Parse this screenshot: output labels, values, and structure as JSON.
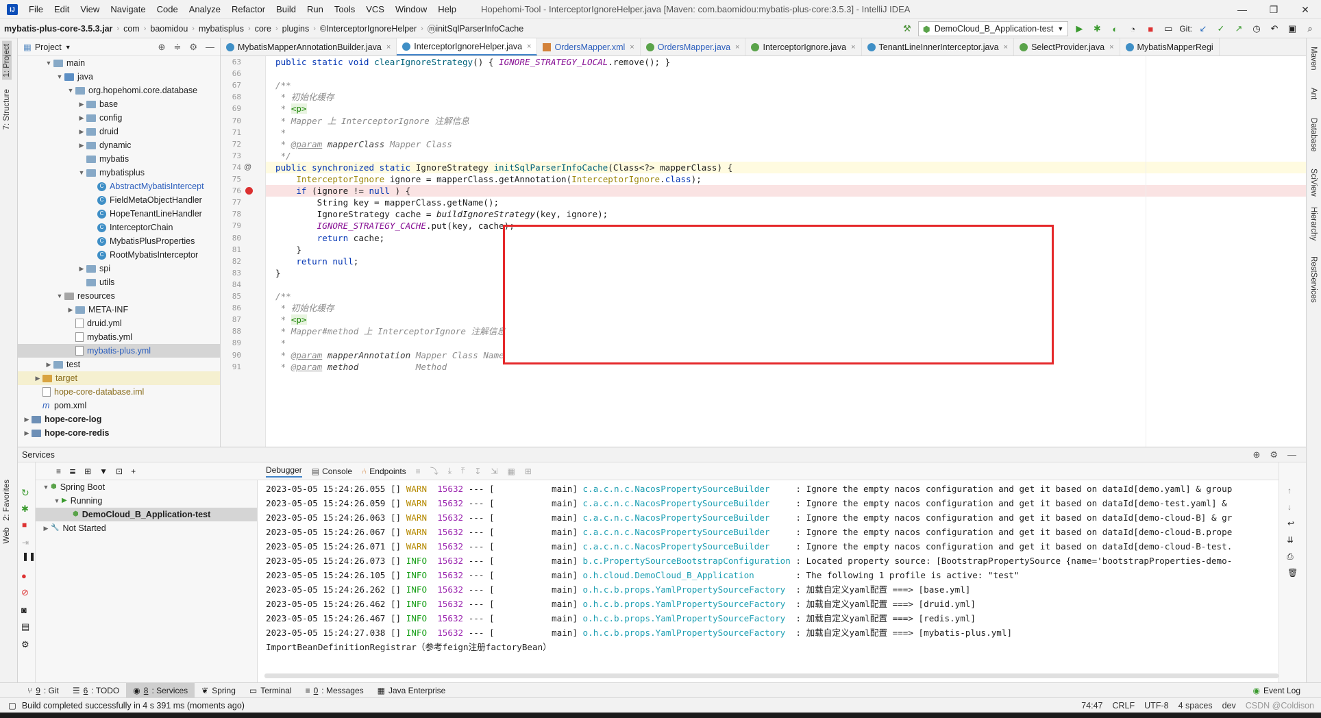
{
  "menubar": {
    "items": [
      "File",
      "Edit",
      "View",
      "Navigate",
      "Code",
      "Analyze",
      "Refactor",
      "Build",
      "Run",
      "Tools",
      "VCS",
      "Window",
      "Help"
    ],
    "window_title": "Hopehomi-Tool - InterceptorIgnoreHelper.java [Maven: com.baomidou:mybatis-plus-core:3.5.3] - IntelliJ IDEA"
  },
  "navbar": {
    "crumbs": [
      "mybatis-plus-core-3.5.3.jar",
      "com",
      "baomidou",
      "mybatisplus",
      "core",
      "plugins",
      "InterceptorIgnoreHelper",
      "initSqlParserInfoCache"
    ],
    "run_config": "DemoCloud_B_Application-test",
    "git_label": "Git:"
  },
  "project": {
    "title": "Project",
    "tree": [
      {
        "label": "main",
        "depth": 2,
        "arrow": "▼",
        "icon": "folder"
      },
      {
        "label": "java",
        "depth": 3,
        "arrow": "▼",
        "icon": "src"
      },
      {
        "label": "org.hopehomi.core.database",
        "depth": 4,
        "arrow": "▼",
        "icon": "folder"
      },
      {
        "label": "base",
        "depth": 5,
        "arrow": "▶",
        "icon": "folder"
      },
      {
        "label": "config",
        "depth": 5,
        "arrow": "▶",
        "icon": "folder"
      },
      {
        "label": "druid",
        "depth": 5,
        "arrow": "▶",
        "icon": "folder"
      },
      {
        "label": "dynamic",
        "depth": 5,
        "arrow": "▶",
        "icon": "folder"
      },
      {
        "label": "mybatis",
        "depth": 5,
        "arrow": "",
        "icon": "folder"
      },
      {
        "label": "mybatisplus",
        "depth": 5,
        "arrow": "▼",
        "icon": "folder"
      },
      {
        "label": "AbstractMybatisIntercept",
        "depth": 6,
        "arrow": "",
        "icon": "class",
        "color": "blue"
      },
      {
        "label": "FieldMetaObjectHandler",
        "depth": 6,
        "arrow": "",
        "icon": "class"
      },
      {
        "label": "HopeTenantLineHandler",
        "depth": 6,
        "arrow": "",
        "icon": "class"
      },
      {
        "label": "InterceptorChain",
        "depth": 6,
        "arrow": "",
        "icon": "class"
      },
      {
        "label": "MybatisPlusProperties",
        "depth": 6,
        "arrow": "",
        "icon": "class"
      },
      {
        "label": "RootMybatisInterceptor",
        "depth": 6,
        "arrow": "",
        "icon": "class"
      },
      {
        "label": "spi",
        "depth": 5,
        "arrow": "▶",
        "icon": "folder"
      },
      {
        "label": "utils",
        "depth": 5,
        "arrow": "",
        "icon": "folder"
      },
      {
        "label": "resources",
        "depth": 3,
        "arrow": "▼",
        "icon": "res"
      },
      {
        "label": "META-INF",
        "depth": 4,
        "arrow": "▶",
        "icon": "folder"
      },
      {
        "label": "druid.yml",
        "depth": 4,
        "arrow": "",
        "icon": "file"
      },
      {
        "label": "mybatis.yml",
        "depth": 4,
        "arrow": "",
        "icon": "file"
      },
      {
        "label": "mybatis-plus.yml",
        "depth": 4,
        "arrow": "",
        "icon": "file",
        "color": "blue",
        "selected": true
      },
      {
        "label": "test",
        "depth": 2,
        "arrow": "▶",
        "icon": "folder"
      },
      {
        "label": "target",
        "depth": 1,
        "arrow": "▶",
        "icon": "target",
        "color": "olive",
        "highlight": true
      },
      {
        "label": "hope-core-database.iml",
        "depth": 1,
        "arrow": "",
        "icon": "file",
        "color": "olive"
      },
      {
        "label": "pom.xml",
        "depth": 1,
        "arrow": "",
        "icon": "m"
      },
      {
        "label": "hope-core-log",
        "depth": 0,
        "arrow": "▶",
        "icon": "module",
        "bold": true
      },
      {
        "label": "hope-core-redis",
        "depth": 0,
        "arrow": "▶",
        "icon": "module",
        "bold": true
      }
    ]
  },
  "editor": {
    "tabs": [
      {
        "label": "MybatisMapperAnnotationBuilder.java",
        "icon": "j"
      },
      {
        "label": "InterceptorIgnoreHelper.java",
        "icon": "j",
        "active": true
      },
      {
        "label": "OrdersMapper.xml",
        "icon": "x",
        "color": "blue"
      },
      {
        "label": "OrdersMapper.java",
        "icon": "i",
        "color": "blue"
      },
      {
        "label": "InterceptorIgnore.java",
        "icon": "a"
      },
      {
        "label": "TenantLineInnerInterceptor.java",
        "icon": "j"
      },
      {
        "label": "SelectProvider.java",
        "icon": "a"
      },
      {
        "label": "MybatisMapperRegi",
        "icon": "j"
      }
    ],
    "line_numbers": [
      "63",
      "66",
      "67",
      "68",
      "69",
      "70",
      "71",
      "72",
      "73",
      "74",
      "75",
      "76",
      "77",
      "78",
      "79",
      "80",
      "81",
      "82",
      "83",
      "84",
      "85",
      "86",
      "87",
      "88",
      "89",
      "90",
      "91"
    ],
    "lines": [
      [
        [
          "k",
          "public static void "
        ],
        [
          "m",
          "clearIgnoreStrategy"
        ],
        [
          "",
          "() { "
        ],
        [
          "st",
          "IGNORE_STRATEGY_LOCAL"
        ],
        [
          "",
          ".remove(); }"
        ]
      ],
      [],
      [
        [
          "cm",
          "/**"
        ]
      ],
      [
        [
          "cm",
          " * 初始化缓存"
        ]
      ],
      [
        [
          "cm",
          " * "
        ],
        [
          "tg",
          "<p>"
        ]
      ],
      [
        [
          "cm",
          " * Mapper 上 InterceptorIgnore 注解信息"
        ]
      ],
      [
        [
          "cm",
          " *"
        ]
      ],
      [
        [
          "cm",
          " * "
        ],
        [
          "cmu",
          "@param"
        ],
        [
          "cm",
          " "
        ],
        [
          "cmp",
          "mapperClass"
        ],
        [
          "cm",
          " Mapper Class"
        ]
      ],
      [
        [
          "cm",
          " */"
        ]
      ],
      [
        [
          "k",
          "public synchronized static "
        ],
        [
          "",
          "IgnoreStrategy "
        ],
        [
          "m",
          "initSqlParserInfoCache"
        ],
        [
          "",
          "(Class<?> mapperClass) {"
        ]
      ],
      [
        [
          "",
          "    "
        ],
        [
          "an",
          "InterceptorIgnore"
        ],
        [
          "",
          " ignore = mapperClass.getAnnotation("
        ],
        [
          "an",
          "InterceptorIgnore"
        ],
        [
          "",
          "."
        ],
        [
          "k",
          "class"
        ],
        [
          "",
          ");"
        ]
      ],
      [
        [
          "",
          "    "
        ],
        [
          "k",
          "if"
        ],
        [
          "",
          " (ignore != "
        ],
        [
          "k",
          "null"
        ],
        [
          "",
          " ) {"
        ]
      ],
      [
        [
          "",
          "        String key = mapperClass.getName();"
        ]
      ],
      [
        [
          "",
          "        IgnoreStrategy cache = "
        ],
        [
          "it",
          "buildIgnoreStrategy"
        ],
        [
          "",
          "(key, ignore);"
        ]
      ],
      [
        [
          "",
          "        "
        ],
        [
          "st",
          "IGNORE_STRATEGY_CACHE"
        ],
        [
          "",
          ".put(key, cache);"
        ]
      ],
      [
        [
          "",
          "        "
        ],
        [
          "k",
          "return"
        ],
        [
          "",
          " cache;"
        ]
      ],
      [
        [
          "",
          "    }"
        ]
      ],
      [
        [
          "",
          "    "
        ],
        [
          "k",
          "return null"
        ],
        [
          "",
          ";"
        ]
      ],
      [
        [
          "",
          "}"
        ]
      ],
      [],
      [
        [
          "cm",
          "/**"
        ]
      ],
      [
        [
          "cm",
          " * 初始化缓存"
        ]
      ],
      [
        [
          "cm",
          " * "
        ],
        [
          "tg",
          "<p>"
        ]
      ],
      [
        [
          "cm",
          " * Mapper#method 上 InterceptorIgnore 注解信息"
        ]
      ],
      [
        [
          "cm",
          " *"
        ]
      ],
      [
        [
          "cm",
          " * "
        ],
        [
          "cmu",
          "@param"
        ],
        [
          "cm",
          " "
        ],
        [
          "cmp",
          "mapperAnnotation"
        ],
        [
          "cm",
          " Mapper Class Name"
        ]
      ],
      [
        [
          "cm",
          " * "
        ],
        [
          "cmu",
          "@param"
        ],
        [
          "cm",
          " "
        ],
        [
          "cmp",
          "method"
        ],
        [
          "cm",
          "           Method"
        ]
      ]
    ]
  },
  "services": {
    "title": "Services",
    "tree": [
      {
        "label": "Spring Boot",
        "depth": 0,
        "arrow": "▼"
      },
      {
        "label": "Running",
        "depth": 1,
        "arrow": "▼",
        "play": true
      },
      {
        "label": "DemoCloud_B_Application-test",
        "depth": 2,
        "arrow": "",
        "bold": true,
        "selected": true
      },
      {
        "label": "Not Started",
        "depth": 0,
        "arrow": "▶"
      }
    ],
    "console_tabs": [
      "Debugger",
      "Console",
      "Endpoints"
    ],
    "logs": [
      {
        "ts": "2023-05-05 15:24:26.055",
        "lvl": "WARN",
        "pid": "15632",
        "thread": "main",
        "logger": "c.a.c.n.c.NacosPropertySourceBuilder",
        "msg": ": Ignore the empty nacos configuration and get it based on dataId[demo.yaml] & group"
      },
      {
        "ts": "2023-05-05 15:24:26.059",
        "lvl": "WARN",
        "pid": "15632",
        "thread": "main",
        "logger": "c.a.c.n.c.NacosPropertySourceBuilder",
        "msg": ": Ignore the empty nacos configuration and get it based on dataId[demo-test.yaml] &"
      },
      {
        "ts": "2023-05-05 15:24:26.063",
        "lvl": "WARN",
        "pid": "15632",
        "thread": "main",
        "logger": "c.a.c.n.c.NacosPropertySourceBuilder",
        "msg": ": Ignore the empty nacos configuration and get it based on dataId[demo-cloud-B] & gr"
      },
      {
        "ts": "2023-05-05 15:24:26.067",
        "lvl": "WARN",
        "pid": "15632",
        "thread": "main",
        "logger": "c.a.c.n.c.NacosPropertySourceBuilder",
        "msg": ": Ignore the empty nacos configuration and get it based on dataId[demo-cloud-B.prope"
      },
      {
        "ts": "2023-05-05 15:24:26.071",
        "lvl": "WARN",
        "pid": "15632",
        "thread": "main",
        "logger": "c.a.c.n.c.NacosPropertySourceBuilder",
        "msg": ": Ignore the empty nacos configuration and get it based on dataId[demo-cloud-B-test."
      },
      {
        "ts": "2023-05-05 15:24:26.073",
        "lvl": "INFO",
        "pid": "15632",
        "thread": "main",
        "logger": "b.c.PropertySourceBootstrapConfiguration",
        "msg": ": Located property source: [BootstrapPropertySource {name='bootstrapProperties-demo-"
      },
      {
        "ts": "2023-05-05 15:24:26.105",
        "lvl": "INFO",
        "pid": "15632",
        "thread": "main",
        "logger": "o.h.cloud.DemoCloud_B_Application",
        "msg": ": The following 1 profile is active: \"test\""
      },
      {
        "ts": "2023-05-05 15:24:26.262",
        "lvl": "INFO",
        "pid": "15632",
        "thread": "main",
        "logger": "o.h.c.b.props.YamlPropertySourceFactory",
        "msg": ": 加载自定义yaml配置 ===> [base.yml]"
      },
      {
        "ts": "2023-05-05 15:24:26.462",
        "lvl": "INFO",
        "pid": "15632",
        "thread": "main",
        "logger": "o.h.c.b.props.YamlPropertySourceFactory",
        "msg": ": 加载自定义yaml配置 ===> [druid.yml]"
      },
      {
        "ts": "2023-05-05 15:24:26.467",
        "lvl": "INFO",
        "pid": "15632",
        "thread": "main",
        "logger": "o.h.c.b.props.YamlPropertySourceFactory",
        "msg": ": 加载自定义yaml配置 ===> [redis.yml]"
      },
      {
        "ts": "2023-05-05 15:24:27.038",
        "lvl": "INFO",
        "pid": "15632",
        "thread": "main",
        "logger": "o.h.c.b.props.YamlPropertySourceFactory",
        "msg": ": 加载自定义yaml配置 ===> [mybatis-plus.yml]"
      }
    ],
    "last_line": "ImportBeanDefinitionRegistrar（参考feign注册factoryBean）"
  },
  "bottom_tools": [
    {
      "num": "9",
      "label": ": Git"
    },
    {
      "num": "6",
      "label": ": TODO"
    },
    {
      "num": "8",
      "label": ": Services",
      "active": true
    },
    {
      "num": "",
      "label": "Spring"
    },
    {
      "num": "",
      "label": "Terminal"
    },
    {
      "num": "0",
      "label": ": Messages"
    },
    {
      "num": "",
      "label": "Java Enterprise"
    }
  ],
  "event_log": "Event Log",
  "left_tabs": {
    "project": "1: Project",
    "structure": "7: Structure",
    "favorites": "2: Favorites",
    "web": "Web"
  },
  "right_tabs": [
    "Maven",
    "Ant",
    "Database",
    "SciView",
    "Hierarchy",
    "RestServices"
  ],
  "status": {
    "message": "Build completed successfully in 4 s 391 ms (moments ago)",
    "position": "74:47",
    "line_sep": "CRLF",
    "encoding": "UTF-8",
    "indent": "4 spaces",
    "branch": "dev",
    "watermark": "CSDN @Coldison"
  }
}
